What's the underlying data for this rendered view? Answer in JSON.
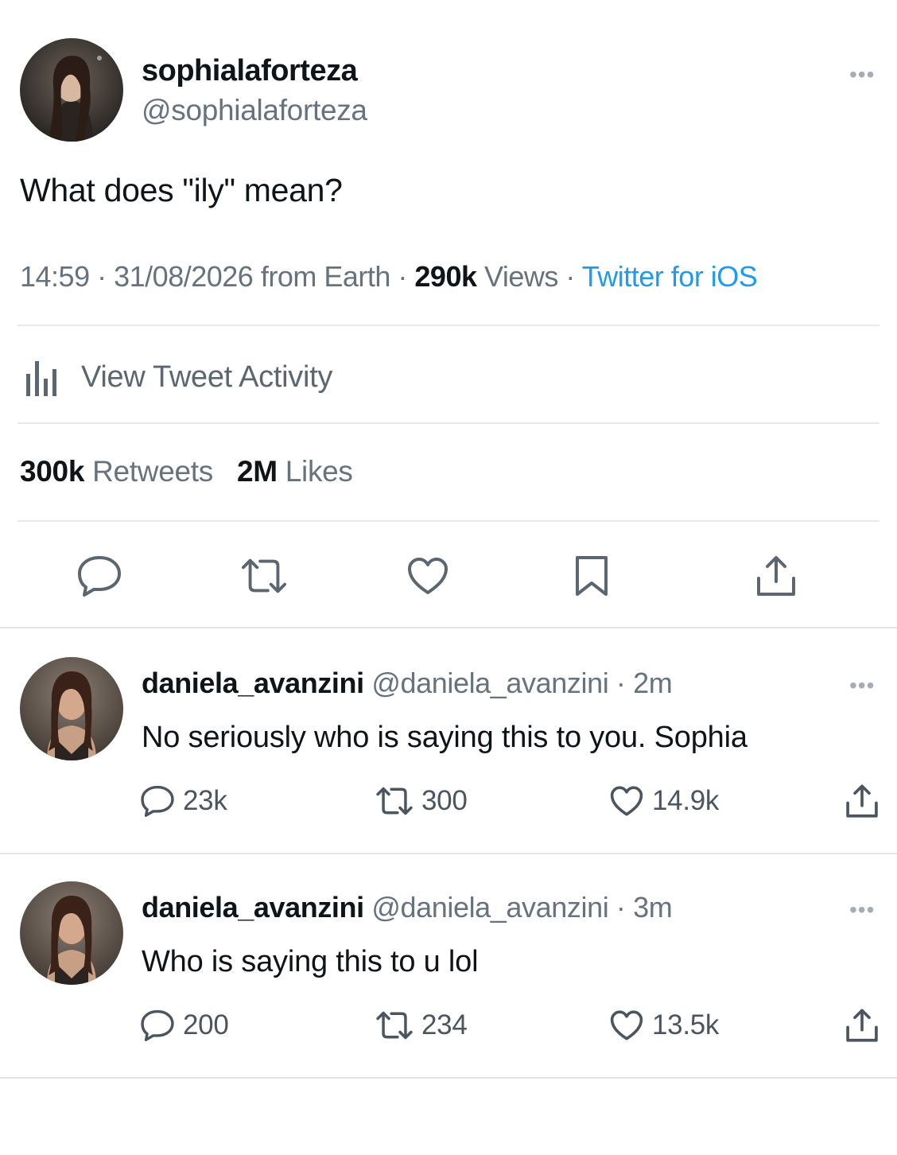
{
  "main_tweet": {
    "display_name": "sophialaforteza",
    "handle": "@sophialaforteza",
    "text": "What does \"ily\" mean?",
    "time": "14:59",
    "date": "31/08/2026",
    "location": "from Earth",
    "views_count": "290k",
    "views_label": "Views",
    "client": "Twitter for iOS",
    "separator": "·",
    "activity_label": "View Tweet Activity",
    "retweets_count": "300k",
    "retweets_label": "Retweets",
    "likes_count": "2M",
    "likes_label": "Likes",
    "more_icon": "more-dots-icon",
    "actions": [
      "reply-icon",
      "retweet-icon",
      "like-icon",
      "bookmark-icon",
      "share-icon"
    ]
  },
  "replies": [
    {
      "display_name": "daniela_avanzini",
      "handle": "@daniela_avanzini",
      "time": "· 2m",
      "text": "No seriously who is saying this to you. Sophia",
      "reply_count": "23k",
      "retweet_count": "300",
      "like_count": "14.9k"
    },
    {
      "display_name": "daniela_avanzini",
      "handle": "@daniela_avanzini",
      "time": "· 3m",
      "text": "Who is saying this to u lol",
      "reply_count": "200",
      "retweet_count": "234",
      "like_count": "13.5k"
    }
  ],
  "colors": {
    "link": "#1d9bf0",
    "muted": "#66737f",
    "text": "#0f1419",
    "divider": "#e7eaed"
  }
}
